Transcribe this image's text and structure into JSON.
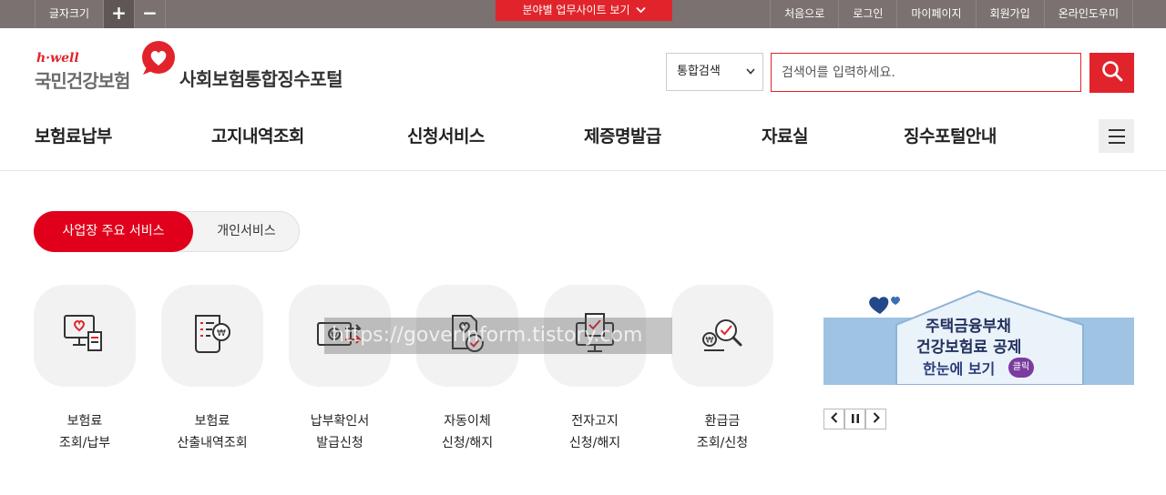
{
  "topbar": {
    "font_size_label": "글자크기",
    "font_plus": "+",
    "font_minus": "−",
    "site_dropdown": "분야별 업무사이트 보기",
    "links": [
      "처음으로",
      "로그인",
      "마이페이지",
      "회원가입",
      "온라인도우미"
    ]
  },
  "header": {
    "logo_brand": "h·well",
    "logo_org": "국민건강보험",
    "portal_title": "사회보험통합징수포털",
    "search": {
      "scope": "통합검색",
      "placeholder": "검색어를 입력하세요."
    }
  },
  "gnb": [
    "보험료납부",
    "고지내역조회",
    "신청서비스",
    "제증명발급",
    "자료실",
    "징수포털안내"
  ],
  "tabs": {
    "active": "사업장 주요 서비스",
    "inactive": "개인서비스"
  },
  "services": [
    {
      "line1": "보험료",
      "line2": "조회/납부",
      "icon": "monitor-heart-receipt-icon"
    },
    {
      "line1": "보험료",
      "line2": "산출내역조회",
      "icon": "document-won-icon"
    },
    {
      "line1": "납부확인서",
      "line2": "발급신청",
      "icon": "card-won-transfer-icon"
    },
    {
      "line1": "자동이체",
      "line2": "신청/해지",
      "icon": "document-heart-check-icon"
    },
    {
      "line1": "전자고지",
      "line2": "신청/해지",
      "icon": "monitor-check-icon"
    },
    {
      "line1": "환급금",
      "line2": "조회/신청",
      "icon": "won-magnifier-check-icon"
    }
  ],
  "banner": {
    "line1": "주택금융부채",
    "line2": "건강보험료 공제",
    "line3": "한눈에 보기",
    "badge": "클릭"
  },
  "slider_controls": {
    "prev": "‹",
    "pause": "❚❚",
    "next": "›"
  },
  "watermark": "https://goverinform.tistory.com",
  "colors": {
    "accent": "#e1242b",
    "topbar": "#7a7170",
    "tile_bg": "#f2f2f2"
  }
}
